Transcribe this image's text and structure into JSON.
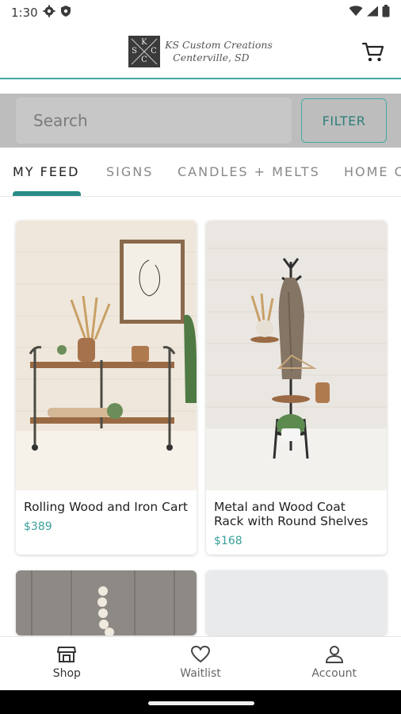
{
  "status_bar": {
    "time": "1:30",
    "icons": [
      "gear-icon",
      "shield-icon",
      "wifi-icon",
      "signal-icon",
      "battery-icon"
    ]
  },
  "header": {
    "logo_letters": [
      "K",
      "S",
      "C",
      "C"
    ],
    "logo_line1": "KS Custom Creations",
    "logo_line2": "Centerville, SD",
    "cart_icon": "cart-icon"
  },
  "search": {
    "placeholder": "Search",
    "filter_label": "FILTER"
  },
  "tabs": [
    {
      "label": "MY FEED",
      "active": true
    },
    {
      "label": "SIGNS",
      "active": false
    },
    {
      "label": "CANDLES + MELTS",
      "active": false
    },
    {
      "label": "HOME C",
      "active": false
    }
  ],
  "products": [
    {
      "title": "Rolling Wood and Iron Cart",
      "price": "$389"
    },
    {
      "title": "Metal and Wood Coat Rack with Round Shelves",
      "price": "$168"
    },
    {
      "title": "",
      "price": ""
    },
    {
      "title": "",
      "price": ""
    }
  ],
  "bottom_nav": [
    {
      "label": "Shop",
      "icon": "shop-icon",
      "active": true
    },
    {
      "label": "Waitlist",
      "icon": "heart-icon",
      "active": false
    },
    {
      "label": "Account",
      "icon": "account-icon",
      "active": false
    }
  ],
  "colors": {
    "accent": "#43a8a3",
    "price": "#3aa09b",
    "search_bg": "#bdbdbd"
  }
}
